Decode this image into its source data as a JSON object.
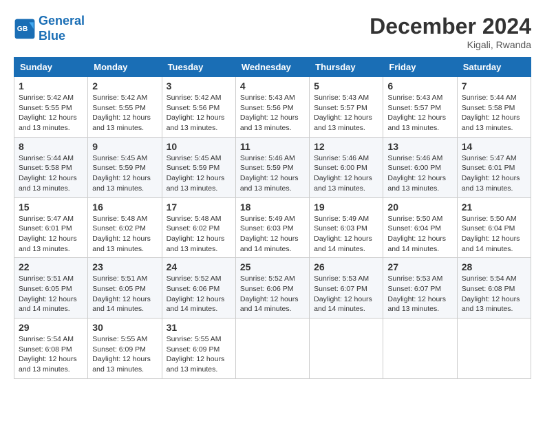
{
  "logo": {
    "line1": "General",
    "line2": "Blue"
  },
  "title": "December 2024",
  "location": "Kigali, Rwanda",
  "days_of_week": [
    "Sunday",
    "Monday",
    "Tuesday",
    "Wednesday",
    "Thursday",
    "Friday",
    "Saturday"
  ],
  "weeks": [
    [
      {
        "day": "1",
        "sunrise": "5:42 AM",
        "sunset": "5:55 PM",
        "daylight": "12 hours and 13 minutes."
      },
      {
        "day": "2",
        "sunrise": "5:42 AM",
        "sunset": "5:55 PM",
        "daylight": "12 hours and 13 minutes."
      },
      {
        "day": "3",
        "sunrise": "5:42 AM",
        "sunset": "5:56 PM",
        "daylight": "12 hours and 13 minutes."
      },
      {
        "day": "4",
        "sunrise": "5:43 AM",
        "sunset": "5:56 PM",
        "daylight": "12 hours and 13 minutes."
      },
      {
        "day": "5",
        "sunrise": "5:43 AM",
        "sunset": "5:57 PM",
        "daylight": "12 hours and 13 minutes."
      },
      {
        "day": "6",
        "sunrise": "5:43 AM",
        "sunset": "5:57 PM",
        "daylight": "12 hours and 13 minutes."
      },
      {
        "day": "7",
        "sunrise": "5:44 AM",
        "sunset": "5:58 PM",
        "daylight": "12 hours and 13 minutes."
      }
    ],
    [
      {
        "day": "8",
        "sunrise": "5:44 AM",
        "sunset": "5:58 PM",
        "daylight": "12 hours and 13 minutes."
      },
      {
        "day": "9",
        "sunrise": "5:45 AM",
        "sunset": "5:59 PM",
        "daylight": "12 hours and 13 minutes."
      },
      {
        "day": "10",
        "sunrise": "5:45 AM",
        "sunset": "5:59 PM",
        "daylight": "12 hours and 13 minutes."
      },
      {
        "day": "11",
        "sunrise": "5:46 AM",
        "sunset": "5:59 PM",
        "daylight": "12 hours and 13 minutes."
      },
      {
        "day": "12",
        "sunrise": "5:46 AM",
        "sunset": "6:00 PM",
        "daylight": "12 hours and 13 minutes."
      },
      {
        "day": "13",
        "sunrise": "5:46 AM",
        "sunset": "6:00 PM",
        "daylight": "12 hours and 13 minutes."
      },
      {
        "day": "14",
        "sunrise": "5:47 AM",
        "sunset": "6:01 PM",
        "daylight": "12 hours and 13 minutes."
      }
    ],
    [
      {
        "day": "15",
        "sunrise": "5:47 AM",
        "sunset": "6:01 PM",
        "daylight": "12 hours and 13 minutes."
      },
      {
        "day": "16",
        "sunrise": "5:48 AM",
        "sunset": "6:02 PM",
        "daylight": "12 hours and 13 minutes."
      },
      {
        "day": "17",
        "sunrise": "5:48 AM",
        "sunset": "6:02 PM",
        "daylight": "12 hours and 13 minutes."
      },
      {
        "day": "18",
        "sunrise": "5:49 AM",
        "sunset": "6:03 PM",
        "daylight": "12 hours and 14 minutes."
      },
      {
        "day": "19",
        "sunrise": "5:49 AM",
        "sunset": "6:03 PM",
        "daylight": "12 hours and 14 minutes."
      },
      {
        "day": "20",
        "sunrise": "5:50 AM",
        "sunset": "6:04 PM",
        "daylight": "12 hours and 14 minutes."
      },
      {
        "day": "21",
        "sunrise": "5:50 AM",
        "sunset": "6:04 PM",
        "daylight": "12 hours and 14 minutes."
      }
    ],
    [
      {
        "day": "22",
        "sunrise": "5:51 AM",
        "sunset": "6:05 PM",
        "daylight": "12 hours and 14 minutes."
      },
      {
        "day": "23",
        "sunrise": "5:51 AM",
        "sunset": "6:05 PM",
        "daylight": "12 hours and 14 minutes."
      },
      {
        "day": "24",
        "sunrise": "5:52 AM",
        "sunset": "6:06 PM",
        "daylight": "12 hours and 14 minutes."
      },
      {
        "day": "25",
        "sunrise": "5:52 AM",
        "sunset": "6:06 PM",
        "daylight": "12 hours and 14 minutes."
      },
      {
        "day": "26",
        "sunrise": "5:53 AM",
        "sunset": "6:07 PM",
        "daylight": "12 hours and 14 minutes."
      },
      {
        "day": "27",
        "sunrise": "5:53 AM",
        "sunset": "6:07 PM",
        "daylight": "12 hours and 13 minutes."
      },
      {
        "day": "28",
        "sunrise": "5:54 AM",
        "sunset": "6:08 PM",
        "daylight": "12 hours and 13 minutes."
      }
    ],
    [
      {
        "day": "29",
        "sunrise": "5:54 AM",
        "sunset": "6:08 PM",
        "daylight": "12 hours and 13 minutes."
      },
      {
        "day": "30",
        "sunrise": "5:55 AM",
        "sunset": "6:09 PM",
        "daylight": "12 hours and 13 minutes."
      },
      {
        "day": "31",
        "sunrise": "5:55 AM",
        "sunset": "6:09 PM",
        "daylight": "12 hours and 13 minutes."
      },
      null,
      null,
      null,
      null
    ]
  ],
  "labels": {
    "sunrise": "Sunrise:",
    "sunset": "Sunset:",
    "daylight": "Daylight:"
  }
}
